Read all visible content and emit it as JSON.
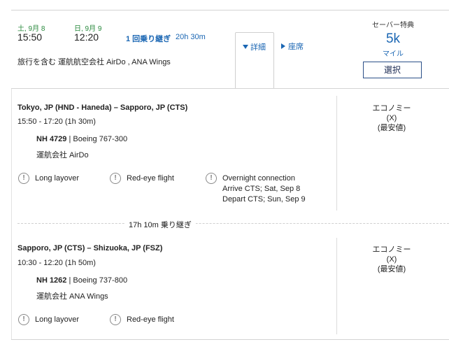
{
  "summary": {
    "dep_date": "土, 9月 8",
    "dep_time": "15:50",
    "arr_date": "日, 9月 9",
    "arr_time": "12:20",
    "stops_label": "1 回乗り継ぎ",
    "duration": "20h 30m",
    "operators": "旅行を含む 運航航空会社 AirDo , ANA Wings",
    "tab_details": "詳細",
    "tab_seats": "座席",
    "fare_label": "セーバー特典",
    "fare_amount": "5k",
    "fare_unit": "マイル",
    "select_label": "選択"
  },
  "segments": [
    {
      "route": "Tokyo, JP (HND - Haneda) – Sapporo, JP (CTS)",
      "times": "15:50 - 17:20 (1h 30m)",
      "flight_no": "NH 4729",
      "aircraft": " | Boeing 767-300",
      "operator": "運航会社 AirDo",
      "cabin": "エコノミー",
      "cabin_code": "(X)",
      "cabin_note": "(最安値)",
      "warnings": [
        "Long layover",
        "Red-eye flight",
        "Overnight connection"
      ],
      "overnight_arrive": "Arrive CTS; Sat, Sep 8",
      "overnight_depart": "Depart CTS; Sun, Sep 9"
    },
    {
      "route": "Sapporo, JP (CTS) – Shizuoka, JP (FSZ)",
      "times": "10:30 - 12:20 (1h 50m)",
      "flight_no": "NH 1262",
      "aircraft": " | Boeing 737-800",
      "operator": "運航会社 ANA Wings",
      "cabin": "エコノミー",
      "cabin_code": "(X)",
      "cabin_note": "(最安値)",
      "warnings": [
        "Long layover",
        "Red-eye flight"
      ]
    }
  ],
  "layover": "17h 10m 乗り継ぎ",
  "icons": {
    "warning": "exclamation-circle-icon",
    "expand": "triangle-down-icon",
    "collapsed": "triangle-right-icon"
  }
}
